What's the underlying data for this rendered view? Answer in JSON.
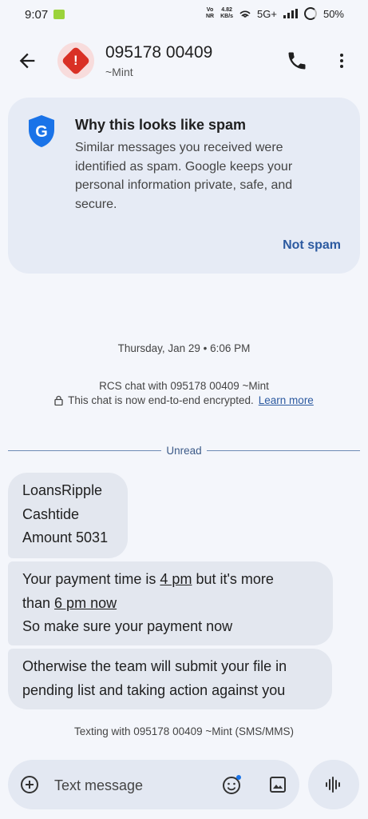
{
  "status_bar": {
    "time": "9:07",
    "network_top": "4.82",
    "network_bottom": "KB/s",
    "volte_top": "Vo",
    "volte_bottom": "NR",
    "network_type": "5G+",
    "battery": "50%"
  },
  "header": {
    "title": "095178 00409",
    "subtitle": "~Mint",
    "avatar_icon": "spam-warning-icon",
    "colors": {
      "warning": "#d93025"
    }
  },
  "spam_card": {
    "title": "Why this looks like spam",
    "body": "Similar messages you received were identified as spam. Google keeps your personal information private, safe, and secure.",
    "action_label": "Not spam",
    "shield_letter": "G",
    "colors": {
      "shield": "#1a73e8",
      "action": "#2c5aa0"
    }
  },
  "conversation": {
    "date": "Thursday, Jan 29 • 6:06 PM",
    "rcs_info": "RCS chat with 095178 00409 ~Mint",
    "encryption_text": "This chat is now end-to-end encrypted.",
    "learn_more": "Learn more",
    "unread_label": "Unread",
    "messages": {
      "m1": {
        "line1": "LoansRipple",
        "line2": "Cashtide",
        "line3": "Amount 5031"
      },
      "m2": {
        "part1": "Your payment time is ",
        "u1": "4 pm",
        "part2": " but it's more",
        "part3": "than ",
        "u2": "6 pm now",
        "line3": "So make sure your payment now"
      },
      "m3": {
        "line1": "Otherwise the team will submit your file in",
        "line2": "pending list and taking action against you"
      }
    },
    "texting_info": "Texting with 095178 00409 ~Mint (SMS/MMS)"
  },
  "composer": {
    "placeholder": "Text message"
  }
}
